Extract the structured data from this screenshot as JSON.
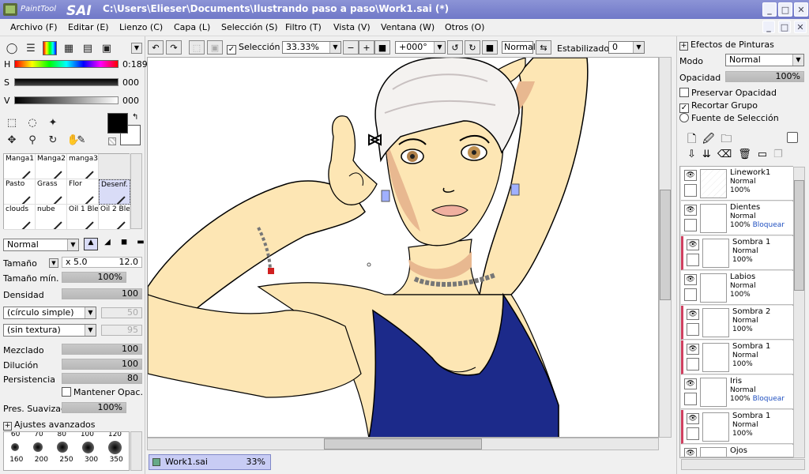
{
  "app": {
    "logo_text": "PaintTool SAI",
    "title": "C:\\Users\\Elieser\\Documents\\Ilustrando paso a paso\\Work1.sai (*)"
  },
  "menu": [
    "Archivo (F)",
    "Editar (E)",
    "Lienzo (C)",
    "Capa (L)",
    "Selección (S)",
    "Filtro (T)",
    "Vista (V)",
    "Ventana (W)",
    "Otros (O)"
  ],
  "color": {
    "h_label": "H",
    "h_value": "0:189",
    "s_label": "S",
    "s_value": "000",
    "v_label": "V",
    "v_value": "000",
    "primary": "#000000",
    "secondary": "#ffffff"
  },
  "brushes": [
    {
      "name": "Manga1"
    },
    {
      "name": "Manga2"
    },
    {
      "name": "manga3"
    },
    {
      "name": ""
    },
    {
      "name": "Pasto"
    },
    {
      "name": "Grass"
    },
    {
      "name": "Flor"
    },
    {
      "name": "Desenf."
    },
    {
      "name": "clouds"
    },
    {
      "name": "nube"
    },
    {
      "name": "Oil 1 Ble"
    },
    {
      "name": "Oil 2 Ble"
    }
  ],
  "brush_settings": {
    "blend_mode": "Normal",
    "size_label": "Tamaño",
    "size_mult": "x 5.0",
    "size_value": "12.0",
    "min_size_label": "Tamaño mín.",
    "min_size_value": "100%",
    "density_label": "Densidad",
    "density_value": "100",
    "shape": "(círculo simple)",
    "shape_value": "50",
    "texture": "(sin textura)",
    "texture_value": "95",
    "blend_label": "Mezclado",
    "blend_value": "100",
    "dilution_label": "Dilución",
    "dilution_value": "100",
    "persistence_label": "Persistencia",
    "persistence_value": "80",
    "keep_opacity": "Mantener Opac.",
    "smooth_label": "Pres. Suavizado",
    "smooth_value": "100%",
    "advanced": "Ajustes avanzados",
    "sizes_top": [
      "60",
      "70",
      "80",
      "100",
      "120"
    ],
    "sizes_bottom": [
      "160",
      "200",
      "250",
      "300",
      "350"
    ]
  },
  "toolbar": {
    "selection_label": "Selección",
    "zoom": "33.33%",
    "rotation": "+000°",
    "mode": "Normal",
    "stabilizer_label": "Estabilizador",
    "stabilizer_value": "0"
  },
  "doc_tab": {
    "name": "Work1.sai",
    "zoom": "33%"
  },
  "effects": {
    "header": "Efectos de Pinturas",
    "mode_label": "Modo",
    "mode_value": "Normal",
    "opacity_label": "Opacidad",
    "opacity_value": "100%",
    "preserve_opacity": "Preservar Opacidad",
    "clip_group": "Recortar Grupo",
    "selection_source": "Fuente de Selección"
  },
  "layers": [
    {
      "name": "Linework1",
      "mode": "Normal",
      "opacity": "100%",
      "lock": ""
    },
    {
      "name": "Dientes",
      "mode": "Normal",
      "opacity": "100%",
      "lock": "Bloquear"
    },
    {
      "name": "Sombra 1",
      "mode": "Normal",
      "opacity": "100%",
      "lock": ""
    },
    {
      "name": "Labios",
      "mode": "Normal",
      "opacity": "100%",
      "lock": ""
    },
    {
      "name": "Sombra 2",
      "mode": "Normal",
      "opacity": "100%",
      "lock": ""
    },
    {
      "name": "Sombra 1",
      "mode": "Normal",
      "opacity": "100%",
      "lock": ""
    },
    {
      "name": "Iris",
      "mode": "Normal",
      "opacity": "100%",
      "lock": "Bloquear"
    },
    {
      "name": "Sombra 1",
      "mode": "Normal",
      "opacity": "100%",
      "lock": ""
    },
    {
      "name": "Ojos",
      "mode": "",
      "opacity": "",
      "lock": ""
    }
  ],
  "colors": {
    "skin": "#fde6b4",
    "shade": "#e8b890",
    "top": "#1c2a8a",
    "hair": "#f4f2f0",
    "title_bar": "#7c84cf"
  }
}
